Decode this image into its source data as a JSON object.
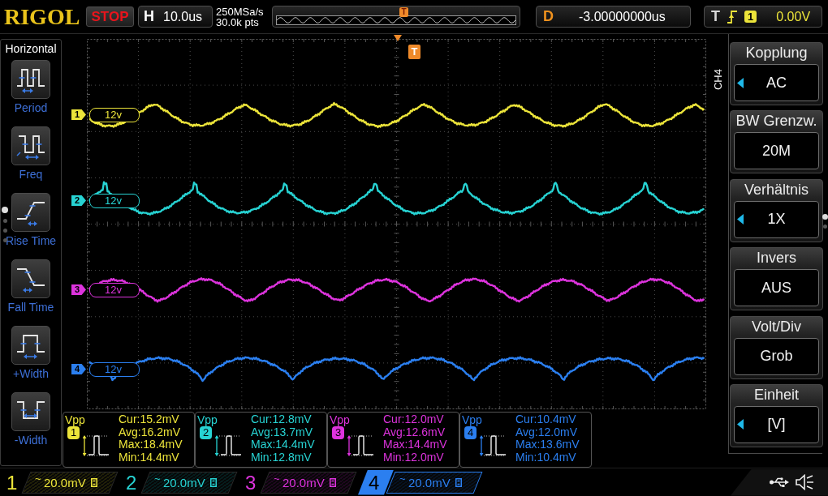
{
  "header": {
    "logo": "RIGOL",
    "run_state": "STOP",
    "timebase": {
      "label": "H",
      "value": "10.0us"
    },
    "sample_rate": "250MSa/s",
    "memory_depth": "30.0k pts",
    "memory_bar": {
      "trigger_marker": "T"
    },
    "delay": {
      "label": "D",
      "value": "-3.00000000us"
    },
    "trigger": {
      "label": "T",
      "source": "1",
      "level": "0.00V"
    }
  },
  "measure_menu": {
    "title": "Horizontal",
    "items": [
      {
        "kind": "period",
        "label": "Period"
      },
      {
        "kind": "freq",
        "label": "Freq"
      },
      {
        "kind": "rise",
        "label": "Rise Time"
      },
      {
        "kind": "fall",
        "label": "Fall Time"
      },
      {
        "kind": "pwidth",
        "label": "+Width"
      },
      {
        "kind": "nwidth",
        "label": "-Width"
      }
    ]
  },
  "display": {
    "trigger_marker": "T",
    "channels": [
      {
        "number": "1",
        "scale_label": "12v",
        "color": "#ece43a"
      },
      {
        "number": "2",
        "scale_label": "12v",
        "color": "#27d3d3"
      },
      {
        "number": "3",
        "scale_label": "12v",
        "color": "#dd33dd"
      },
      {
        "number": "4",
        "scale_label": "12v",
        "color": "#2b7ff0"
      }
    ]
  },
  "measurements": [
    {
      "name": "Vpp",
      "channel": "1",
      "color": "#ece43a",
      "stats": [
        "Cur:15.2mV",
        "Avg:16.2mV",
        "Max:18.4mV",
        "Min:14.4mV"
      ]
    },
    {
      "name": "Vpp",
      "channel": "2",
      "color": "#27d3d3",
      "stats": [
        "Cur:12.8mV",
        "Avg:13.7mV",
        "Max:14.4mV",
        "Min:12.8mV"
      ]
    },
    {
      "name": "Vpp",
      "channel": "3",
      "color": "#dd33dd",
      "stats": [
        "Cur:12.0mV",
        "Avg:12.6mV",
        "Max:14.4mV",
        "Min:12.0mV"
      ]
    },
    {
      "name": "Vpp",
      "channel": "4",
      "color": "#2b7ff0",
      "stats": [
        "Cur:10.4mV",
        "Avg:12.0mV",
        "Max:13.6mV",
        "Min:10.4mV"
      ]
    }
  ],
  "channel_menu": {
    "channel": "CH4",
    "items": [
      {
        "title": "Kopplung",
        "value": "AC",
        "knob": true
      },
      {
        "title": "BW Grenzw.",
        "value": "20M",
        "knob": false
      },
      {
        "title": "Verhältnis",
        "value": "1X",
        "knob": true
      },
      {
        "title": "Invers",
        "value": "AUS",
        "knob": false
      },
      {
        "title": "Volt/Div",
        "value": "Grob",
        "knob": false
      },
      {
        "title": "Einheit",
        "value": "[V]",
        "knob": true
      }
    ]
  },
  "channel_bar": [
    {
      "number": "1",
      "coupling": "~",
      "scale": "20.0mV",
      "bw_limit": true,
      "selected": false,
      "color": "#ece43a"
    },
    {
      "number": "2",
      "coupling": "~",
      "scale": "20.0mV",
      "bw_limit": true,
      "selected": false,
      "color": "#27d3d3"
    },
    {
      "number": "3",
      "coupling": "~",
      "scale": "20.0mV",
      "bw_limit": true,
      "selected": false,
      "color": "#dd33dd"
    },
    {
      "number": "4",
      "coupling": "~",
      "scale": "20.0mV",
      "bw_limit": true,
      "selected": true,
      "color": "#2b7ff0"
    }
  ]
}
